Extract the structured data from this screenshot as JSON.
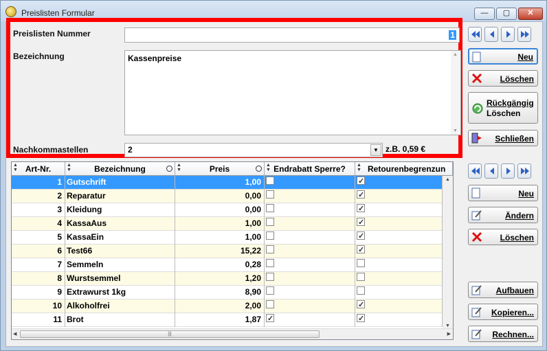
{
  "window": {
    "title": "Preislisten Formular",
    "minimize": "—",
    "maximize": "▢",
    "close": "✕"
  },
  "form": {
    "number_label": "Preislisten Nummer",
    "number_value": "1",
    "desc_label": "Bezeichnung",
    "desc_value": "Kassenpreise",
    "decimals_label": "Nachkommastellen",
    "decimals_value": "2",
    "example": "z.B. 0,59 €"
  },
  "header_buttons": {
    "neu": "Neu",
    "loeschen": "Löschen",
    "undo_line1": "Rückgängig",
    "undo_line2": "Löschen",
    "schliessen": "Schließen"
  },
  "detail_buttons": {
    "neu": "Neu",
    "aendern": "Ändern",
    "loeschen": "Löschen",
    "aufbauen": "Aufbauen",
    "kopieren": "Kopieren...",
    "rechnen": "Rechnen..."
  },
  "table": {
    "headers": [
      "Art-Nr.",
      "Bezeichnung",
      "Preis",
      "Endrabatt Sperre?",
      "Retourenbegrenzun"
    ],
    "rows": [
      {
        "nr": "1",
        "bez": "Gutschrift",
        "preis": "1,00",
        "end": false,
        "ret": true
      },
      {
        "nr": "2",
        "bez": "Reparatur",
        "preis": "0,00",
        "end": false,
        "ret": true
      },
      {
        "nr": "3",
        "bez": "Kleidung",
        "preis": "0,00",
        "end": false,
        "ret": true
      },
      {
        "nr": "4",
        "bez": "KassaAus",
        "preis": "1,00",
        "end": false,
        "ret": true
      },
      {
        "nr": "5",
        "bez": "KassaEin",
        "preis": "1,00",
        "end": false,
        "ret": true
      },
      {
        "nr": "6",
        "bez": "Test66",
        "preis": "15,22",
        "end": false,
        "ret": true
      },
      {
        "nr": "7",
        "bez": "Semmeln",
        "preis": "0,28",
        "end": false,
        "ret": false
      },
      {
        "nr": "8",
        "bez": "Wurstsemmel",
        "preis": "1,20",
        "end": false,
        "ret": false
      },
      {
        "nr": "9",
        "bez": "Extrawurst 1kg",
        "preis": "8,90",
        "end": false,
        "ret": false
      },
      {
        "nr": "10",
        "bez": "Alkoholfrei",
        "preis": "2,00",
        "end": false,
        "ret": true
      },
      {
        "nr": "11",
        "bez": "Brot",
        "preis": "1,87",
        "end": true,
        "ret": true
      }
    ]
  }
}
